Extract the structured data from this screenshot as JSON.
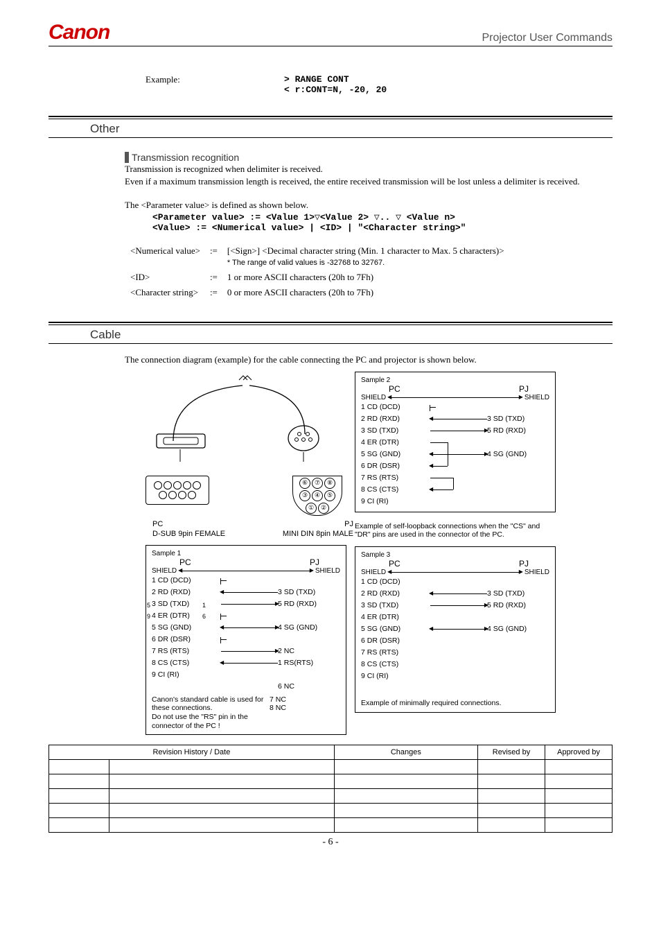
{
  "header": {
    "logo": "Canon",
    "title": "Projector User Commands"
  },
  "example": {
    "label": "Example:",
    "line1": "> RANGE CONT",
    "line2": "< r:CONT=N, -20, 20"
  },
  "other": {
    "heading": "Other",
    "sub": "Transmission recognition",
    "p1": "Transmission is recognized when delimiter is received.",
    "p2": "Even if a maximum transmission length is received, the entire received transmission will be lost unless a delimiter is received.",
    "p3": "The <Parameter value> is defined as shown below.",
    "def1": "<Parameter value> := <Value 1>▽<Value 2> ▽.. ▽ <Value n>",
    "def2": "<Value> := <Numerical value> | <ID> | \"<Character string>\"",
    "rows": [
      {
        "k": "<Numerical value>",
        "op": ":=",
        "v": "[<Sign>] <Decimal character string (Min. 1 character to Max. 5 characters)>",
        "note": "* The range of valid values is -32768 to 32767."
      },
      {
        "k": "<ID>",
        "op": ":=",
        "v": "1 or more ASCII characters (20h to 7Fh)"
      },
      {
        "k": "<Character string>",
        "op": ":=",
        "v": "0 or more ASCII characters (20h to 7Fh)"
      }
    ]
  },
  "cable": {
    "heading": "Cable",
    "intro": "The connection diagram (example) for the cable connecting the PC and projector is shown below.",
    "pc": "PC",
    "pj": "PJ",
    "dsub": "D-SUB 9pin FEMALE",
    "minidin": "MINI DIN 8pin MALE",
    "shield": "SHIELD",
    "pc_pins": [
      "1   CD (DCD)",
      "2   RD (RXD)",
      "3   SD (TXD)",
      "4   ER (DTR)",
      "5   SG (GND)",
      "6   DR (DSR)",
      "7   RS (RTS)",
      "8   CS (CTS)",
      "9   CI (RI)"
    ],
    "pj_pins": {
      "0": "3   SD (TXD)",
      "1": "5   RD (RXD)",
      "2": "4   SG (GND)",
      "3": "2   NC",
      "4": "1   RS(RTS)",
      "5": "6   NC",
      "6": "7   NC",
      "7": "8   NC"
    },
    "sample1_note": "Canon's standard cable is used for these connections.\nDo not use the \"RS\" pin in the connector of the PC !",
    "sample2_note": "Example of self-loopback connections when the \"CS\" and \"DR\" pins are used in the connector of the PC.",
    "sample3_note": "Example of minimally required connections.",
    "s1": "Sample 1",
    "s2": "Sample 2",
    "s3": "Sample 3"
  },
  "rev": {
    "h1": "Revision History / Date",
    "h2": "Changes",
    "h3": "Revised by",
    "h4": "Approved by"
  },
  "pagenum": "- 6 -"
}
